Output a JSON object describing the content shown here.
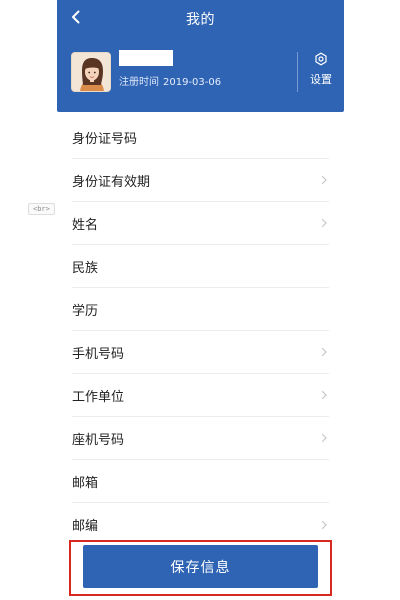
{
  "header": {
    "title": "我的",
    "back_icon": "chevron-left-icon",
    "registration_label": "注册时间",
    "registration_date": "2019-03-06",
    "settings_label": "设置",
    "settings_icon": "gear-icon",
    "accent_color": "#2f64b4"
  },
  "form": {
    "rows": [
      {
        "label": "身份证号码"
      },
      {
        "label": "身份证有效期"
      },
      {
        "label": "姓名"
      },
      {
        "label": "民族"
      },
      {
        "label": "学历"
      },
      {
        "label": "手机号码"
      },
      {
        "label": "工作单位"
      },
      {
        "label": "座机号码"
      },
      {
        "label": "邮箱"
      },
      {
        "label": "邮编"
      }
    ],
    "br_tag": "<br>"
  },
  "actions": {
    "save_label": "保存信息",
    "highlight_color": "#d9281f"
  }
}
